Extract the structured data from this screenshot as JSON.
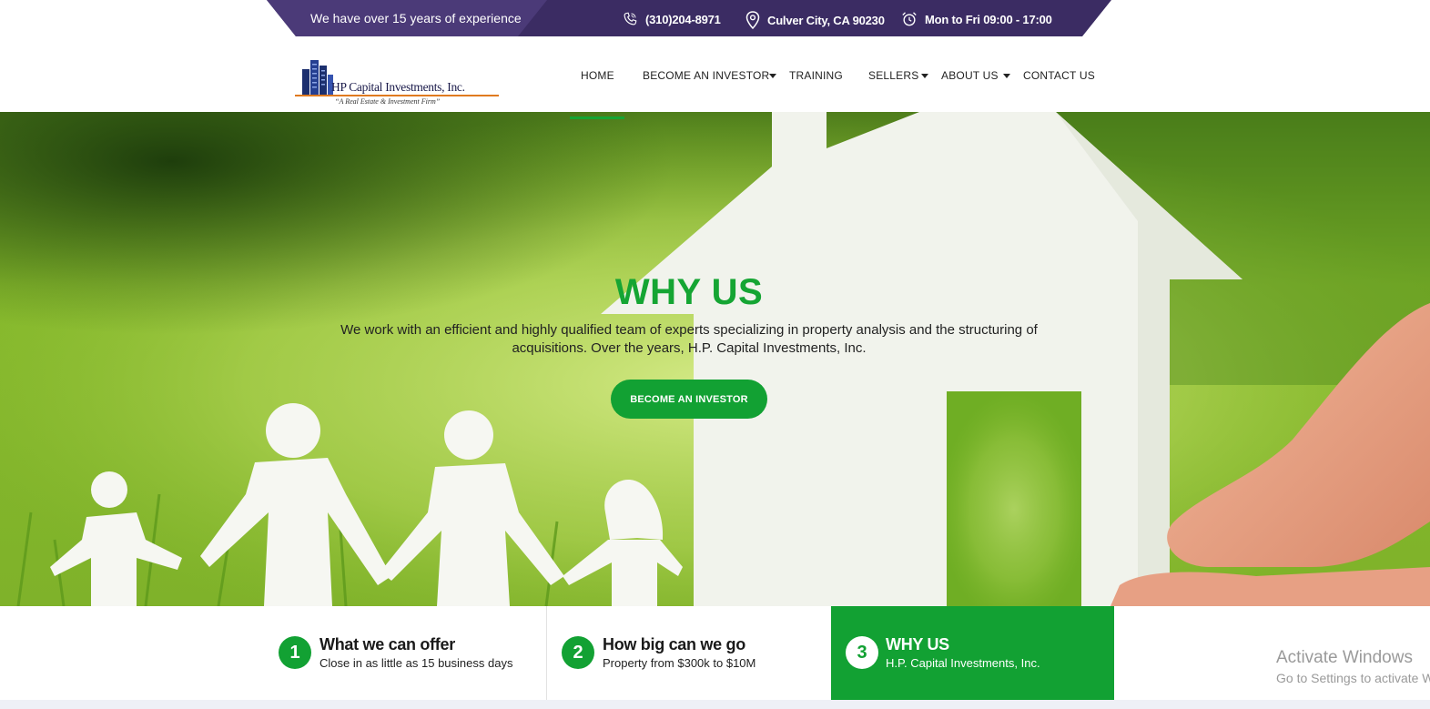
{
  "topbar": {
    "experience": "We have over 15 years of experience",
    "phone": "(310)204-8971",
    "location": "Culver City, CA 90230",
    "hours": "Mon to Fri 09:00 - 17:00",
    "colors": {
      "dark": "#3b2c63",
      "light": "#4b3a78"
    }
  },
  "logo": {
    "name": "HP Capital Investments, Inc.",
    "tagline": "“A Real Estate & Investment Firm”"
  },
  "nav": {
    "items": [
      {
        "label": "HOME",
        "active": true
      },
      {
        "label": "BECOME AN INVESTOR",
        "dropdown": true
      },
      {
        "label": "TRAINING"
      },
      {
        "label": "SELLERS",
        "dropdown": true
      },
      {
        "label": "ABOUT US",
        "dropdown": true
      },
      {
        "label": "CONTACT US"
      }
    ]
  },
  "hero": {
    "title": "WHY US",
    "text": "We work with an efficient and highly qualified team of experts specializing in property analysis and the structuring of acquisitions. Over the years, H.P. Capital Investments, Inc.",
    "button": "BECOME AN INVESTOR"
  },
  "steps": [
    {
      "number": "1",
      "title": "What we can offer",
      "subtitle": "Close in as little as 15 business days",
      "active": false
    },
    {
      "number": "2",
      "title": "How big can we go",
      "subtitle": "Property from $300k to $10M",
      "active": false
    },
    {
      "number": "3",
      "title": "WHY US",
      "subtitle": "H.P. Capital Investments, Inc.",
      "active": true
    }
  ],
  "watermark": {
    "line1": "Activate Windows",
    "line2": "Go to Settings to activate Windows."
  },
  "colors": {
    "accent": "#12a133",
    "heading_green": "#15a533"
  }
}
